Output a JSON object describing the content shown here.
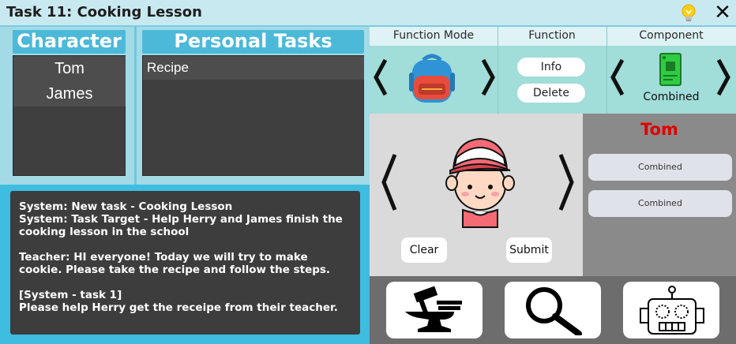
{
  "window": {
    "title": "Task 11: Cooking Lesson"
  },
  "icons": {
    "hint": "lightbulb-icon",
    "close": "close-icon",
    "backpack": "backpack-icon",
    "component": "circuit-chip-icon",
    "avatar": "boy-cap-avatar",
    "craft": "anvil-hammer-icon",
    "search": "magnifier-icon",
    "robot": "robot-icon"
  },
  "left": {
    "character_header": "Character",
    "characters": [
      "Tom",
      "James"
    ],
    "tasks_header": "Personal Tasks",
    "tasks": [
      "Recipe"
    ]
  },
  "log": {
    "text": "System: New task - Cooking Lesson\nSystem: Task Target - Help Herry and James finish the cooking lesson in the school\n\nTeacher: HI everyone! Today we will try to make cookie. Please take the recipe and follow the steps.\n\n[System - task 1]\nPlease help Herry get the receipe from their teacher."
  },
  "function": {
    "mode_label": "Function Mode",
    "function_label": "Function",
    "component_label": "Component",
    "info_button": "Info",
    "delete_button": "Delete",
    "component_name": "Combined"
  },
  "avatar": {
    "clear_button": "Clear",
    "submit_button": "Submit"
  },
  "character_panel": {
    "name": "Tom",
    "slots": [
      "Combined",
      "Combined"
    ]
  },
  "colors": {
    "accent": "#4cb9d9",
    "name_red": "#e10000"
  }
}
